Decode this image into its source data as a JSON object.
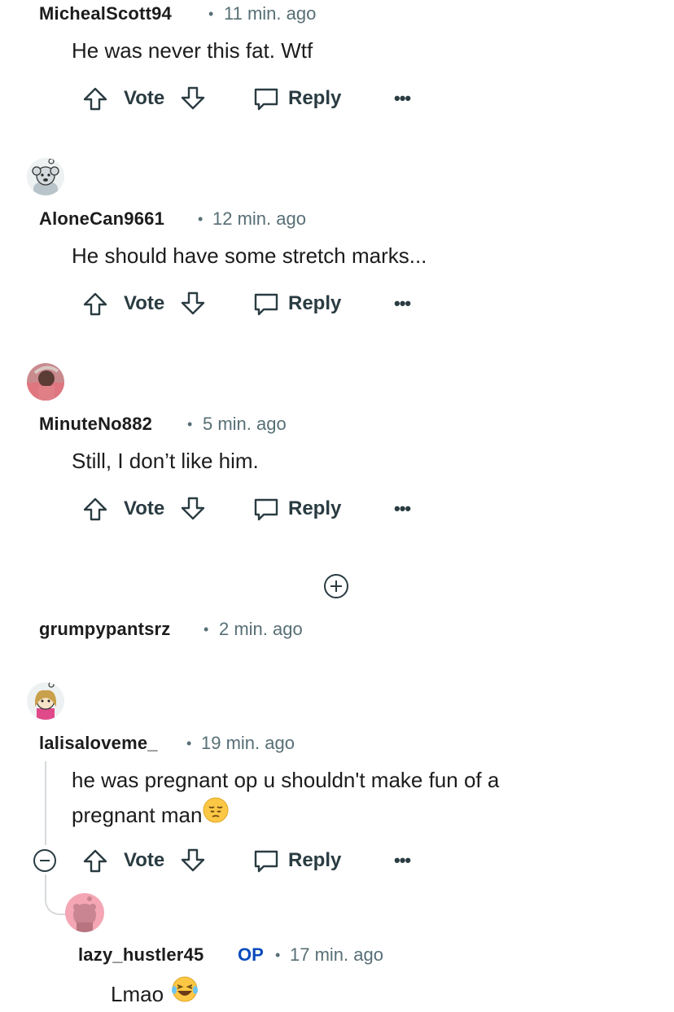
{
  "actions": {
    "vote_label": "Vote",
    "reply_label": "Reply",
    "more_label": "•••",
    "expand_label": "+",
    "collapse_label": "−"
  },
  "comments": [
    {
      "username": "MichealScott94",
      "time": "11 min. ago",
      "text": "He was never this fat. Wtf"
    },
    {
      "username": "AloneCan9661",
      "time": "12 min. ago",
      "text": "He should have some stretch marks..."
    },
    {
      "username": "MinuteNo882",
      "time": "5 min. ago",
      "text": "Still, I don’t like him."
    },
    {
      "username": "grumpypantsrz",
      "time": "2 min. ago",
      "collapsed": true
    },
    {
      "username": "lalisaloveme_",
      "time": "19 min. ago",
      "text_line1": "he was pregnant op u shouldn't make fun of a",
      "text_line2": "pregnant man"
    },
    {
      "username": "lazy_hustler45",
      "badge": "OP",
      "time": "17 min. ago",
      "text": "Lmao"
    }
  ],
  "separator": "•",
  "icons": [
    "upvote-icon",
    "downvote-icon",
    "reply-icon",
    "more-icon",
    "expand-icon",
    "collapse-icon",
    "pensive-emoji-icon",
    "laughing-emoji-icon"
  ],
  "colors": {
    "username": "#1c1c1c",
    "meta": "#576f76",
    "op_badge": "#0a4bbd",
    "action": "#2a3c42",
    "thread_line": "#d6dadc"
  }
}
